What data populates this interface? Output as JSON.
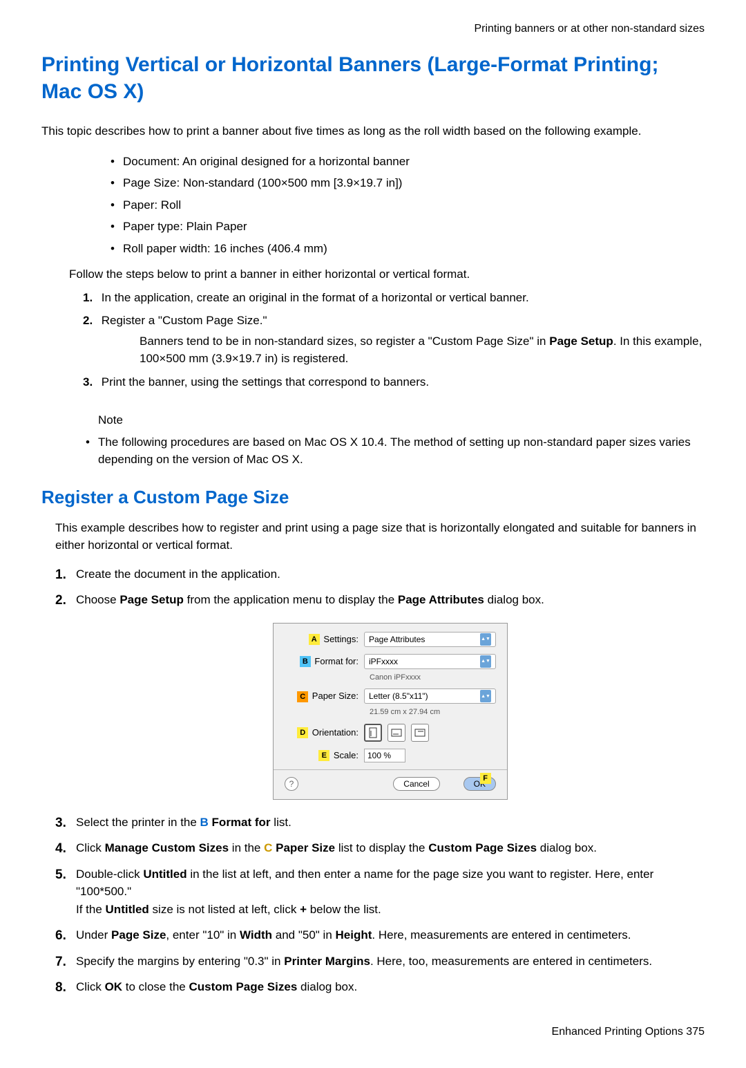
{
  "header": "Printing banners or at other non-standard sizes",
  "title": "Printing Vertical or Horizontal Banners (Large-Format Printing; Mac OS X)",
  "intro": "This topic describes how to print a banner about five times as long as the roll width based on the following example.",
  "bullets": {
    "b1": "Document: An original designed for a horizontal banner",
    "b2": "Page Size: Non-standard (100×500 mm [3.9×19.7 in])",
    "b3": "Paper: Roll",
    "b4": "Paper type: Plain Paper",
    "b5": "Roll paper width: 16 inches (406.4 mm)"
  },
  "follow": "Follow the steps below to print a banner in either horizontal or vertical format.",
  "pre_steps": {
    "n1": "1.",
    "t1": "In the application, create an original in the format of a horizontal or vertical banner.",
    "n2": "2.",
    "t2": "Register a \"Custom Page Size.\"",
    "t2b_a": "Banners tend to be in non-standard sizes, so register a \"Custom Page Size\" in ",
    "t2b_bold": "Page Setup",
    "t2b_c": ". In this example, 100×500 mm (3.9×19.7 in) is registered.",
    "n3": "3.",
    "t3": "Print the banner, using the settings that correspond to banners."
  },
  "note": {
    "label": "Note",
    "text": "The following procedures are based on Mac OS X 10.4. The method of setting up non-standard paper sizes varies depending on the version of Mac OS X."
  },
  "h2": "Register a Custom Page Size",
  "h2_desc": "This example describes how to register and print using a page size that is horizontally elongated and suitable for banners in either horizontal or vertical format.",
  "steps": {
    "s1": {
      "num": "1.",
      "text": "Create the document in the application."
    },
    "s2": {
      "num": "2.",
      "a": "Choose ",
      "b": "Page Setup",
      "c": " from the application menu to display the ",
      "d": "Page Attributes",
      "e": " dialog box."
    },
    "s3": {
      "num": "3.",
      "a": "Select the printer in the ",
      "letter": "B",
      "b": " Format for",
      "c": " list."
    },
    "s4": {
      "num": "4.",
      "a": "Click ",
      "b": "Manage Custom Sizes",
      "c": " in the ",
      "letter": "C",
      "d": " Paper Size",
      "e": " list to display the ",
      "f": "Custom Page Sizes",
      "g": " dialog box."
    },
    "s5": {
      "num": "5.",
      "a": "Double-click ",
      "b": "Untitled",
      "c": " in the list at left, and then enter a name for the page size you want to register. Here, enter \"100*500.\"",
      "line2a": "If the ",
      "line2b": "Untitled",
      "line2c": " size is not listed at left, click ",
      "line2d": "+",
      "line2e": " below the list."
    },
    "s6": {
      "num": "6.",
      "a": "Under ",
      "b": "Page Size",
      "c": ", enter \"10\" in ",
      "d": "Width",
      "e": " and \"50\" in ",
      "f": "Height",
      "g": ". Here, measurements are entered in centimeters."
    },
    "s7": {
      "num": "7.",
      "a": "Specify the margins by entering \"0.3\" in ",
      "b": "Printer Margins",
      "c": ". Here, too, measurements are entered in centimeters."
    },
    "s8": {
      "num": "8.",
      "a": "Click ",
      "b": "OK",
      "c": " to close the ",
      "d": "Custom Page Sizes",
      "e": " dialog box."
    }
  },
  "dialog": {
    "labels": {
      "settings": "Settings:",
      "format_for": "Format for:",
      "paper_size": "Paper Size:",
      "orientation": "Orientation:",
      "scale": "Scale:"
    },
    "values": {
      "settings": "Page Attributes",
      "format_for": "iPFxxxx",
      "format_sub": "Canon iPFxxxx",
      "paper_size": "Letter (8.5\"x11\")",
      "paper_sub": "21.59 cm x 27.94 cm",
      "scale": "100 %"
    },
    "letters": {
      "a": "A",
      "b": "B",
      "c": "C",
      "d": "D",
      "e": "E",
      "f": "F"
    },
    "help": "?",
    "cancel": "Cancel",
    "ok": "OK"
  },
  "footer": "Enhanced Printing Options  375"
}
